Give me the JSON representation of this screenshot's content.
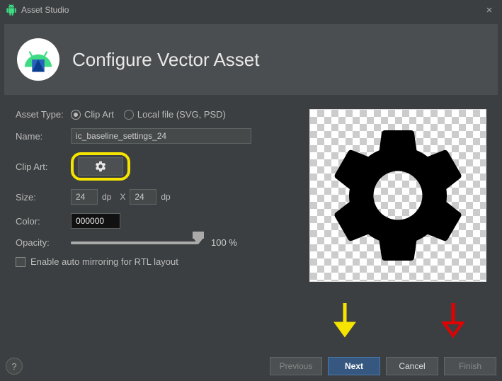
{
  "window": {
    "title": "Asset Studio"
  },
  "header": {
    "title": "Configure Vector Asset"
  },
  "form": {
    "asset_type_label": "Asset Type:",
    "asset_type_options": {
      "clip_art": "Clip Art",
      "local_file": "Local file (SVG, PSD)"
    },
    "name_label": "Name:",
    "name_value": "ic_baseline_settings_24",
    "clipart_label": "Clip Art:",
    "size_label": "Size:",
    "size_w": "24",
    "size_h": "24",
    "size_unit": "dp",
    "size_sep": "X",
    "color_label": "Color:",
    "color_value": "000000",
    "opacity_label": "Opacity:",
    "opacity_value": "100 %",
    "rtl_label": "Enable auto mirroring for RTL layout"
  },
  "footer": {
    "previous": "Previous",
    "next": "Next",
    "cancel": "Cancel",
    "finish": "Finish",
    "help": "?"
  }
}
